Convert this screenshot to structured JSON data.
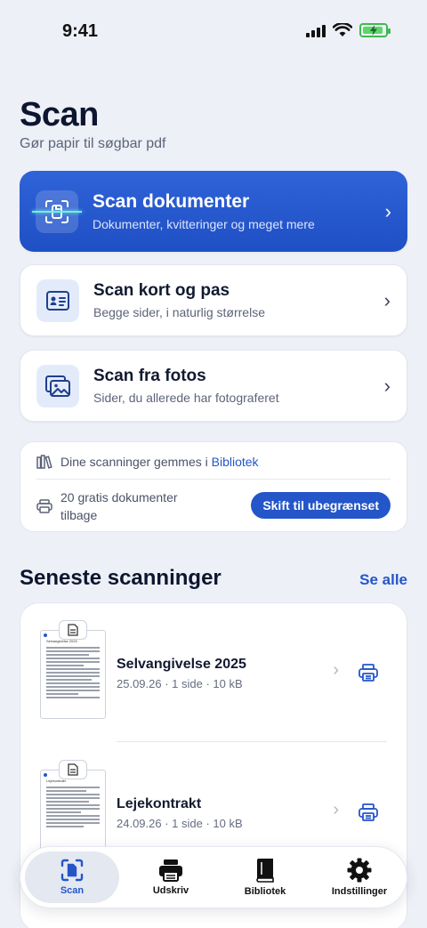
{
  "status": {
    "time": "9:41"
  },
  "header": {
    "title": "Scan",
    "subtitle": "Gør papir til søgbar pdf"
  },
  "scan_options": [
    {
      "title": "Scan dokumenter",
      "subtitle": "Dokumenter, kvitteringer og meget mere",
      "icon": "scan-document-icon"
    },
    {
      "title": "Scan kort og pas",
      "subtitle": "Begge sider, i naturlig størrelse",
      "icon": "id-card-icon"
    },
    {
      "title": "Scan fra fotos",
      "subtitle": "Sider, du allerede har fotograferet",
      "icon": "photos-icon"
    }
  ],
  "info": {
    "saved_prefix": "Dine scanninger gemmes i",
    "saved_link": "Bibliotek",
    "free_docs": "20 gratis dokumenter tilbage",
    "upgrade_label": "Skift til ubegrænset"
  },
  "recent": {
    "title": "Seneste scanninger",
    "see_all": "Se alle",
    "items": [
      {
        "title": "Selvangivelse 2025",
        "meta": "25.09.26 · 1 side · 10 kB",
        "thumb_heading": "Selvangivelse 2025"
      },
      {
        "title": "Lejekontrakt",
        "meta": "24.09.26 · 1 side · 10 kB",
        "thumb_heading": "Lejekontrakt"
      }
    ]
  },
  "tabs": [
    {
      "label": "Scan",
      "icon": "scan-icon",
      "active": true
    },
    {
      "label": "Udskriv",
      "icon": "printer-icon",
      "active": false
    },
    {
      "label": "Bibliotek",
      "icon": "library-icon",
      "active": false
    },
    {
      "label": "Indstillinger",
      "icon": "gear-icon",
      "active": false
    }
  ],
  "colors": {
    "accent": "#2456c9",
    "primary_card": "#2a5bd3",
    "background": "#eef0f7"
  }
}
